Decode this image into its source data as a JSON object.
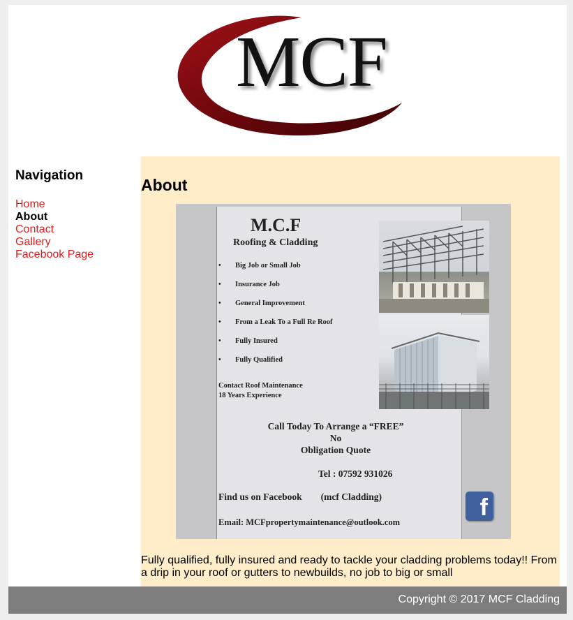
{
  "header": {
    "logo_text": "MCF",
    "logo_swoosh_color": "#7a0a0e"
  },
  "nav": {
    "title": "Navigation",
    "items": [
      {
        "label": "Home",
        "current": false
      },
      {
        "label": "About",
        "current": true
      },
      {
        "label": "Contact",
        "current": false
      },
      {
        "label": "Gallery",
        "current": false
      },
      {
        "label": "Facebook Page",
        "current": false
      }
    ],
    "link_color": "#e21c1c"
  },
  "main": {
    "heading": "About",
    "background": "#ffedc9",
    "flyer": {
      "title": "M.C.F",
      "subtitle": "Roofing & Cladding",
      "services": [
        "Big Job or Small Job",
        "Insurance Job",
        "General Improvement",
        "From a Leak To a Full Re Roof",
        "Fully Insured",
        "Fully Qualified"
      ],
      "contact_line1": "Contact Roof Maintenance",
      "contact_line2": "18 Years Experience",
      "call_line1": "Call Today To Arrange a “FREE”",
      "call_line2": "No",
      "call_line3": "Obligation Quote",
      "tel": "Tel : 07592 931026",
      "facebook": "Find us on Facebook        (mcf Cladding)",
      "email": "Email: MCFpropertymaintenance@outlook.com",
      "facebook_icon": "facebook-icon"
    },
    "description": "Fully qualified, fully insured and ready to tackle your cladding problems today!! From a drip in your roof or gutters to newbuilds, no job to big or small"
  },
  "footer": {
    "copyright": "Copyright © 2017 MCF Cladding",
    "background": "#7d7d7d"
  }
}
